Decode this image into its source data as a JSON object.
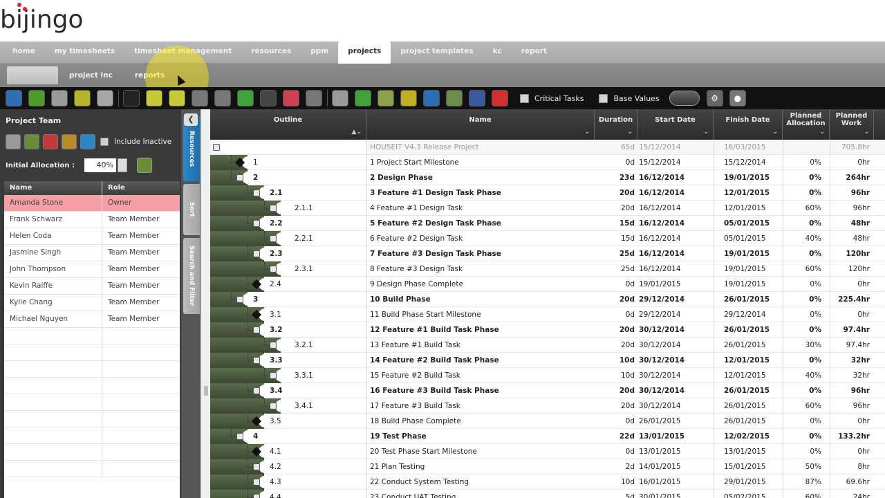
{
  "app": {
    "logo": "bijingo"
  },
  "main_nav": [
    {
      "label": "home",
      "active": false
    },
    {
      "label": "my timesheets",
      "active": false
    },
    {
      "label": "timesheet management",
      "active": false
    },
    {
      "label": "resources",
      "active": false
    },
    {
      "label": "ppm",
      "active": false
    },
    {
      "label": "projects",
      "active": true
    },
    {
      "label": "project templates",
      "active": false
    },
    {
      "label": "kc",
      "active": false
    },
    {
      "label": "report",
      "active": false
    }
  ],
  "sub_nav": [
    {
      "label": "",
      "active": true
    },
    {
      "label": "project inc",
      "active": false
    },
    {
      "label": "reports",
      "active": false
    }
  ],
  "toolbar": {
    "critical_tasks_label": "Critical Tasks",
    "base_values_label": "Base Values",
    "buttons": [
      {
        "icon": "back-icon",
        "color": "#2d6fb6"
      },
      {
        "icon": "add-icon",
        "color": "#4e9a2b"
      },
      {
        "icon": "settings-icon",
        "color": "#9a9a9a"
      },
      {
        "icon": "cube-icon",
        "color": "#b5b52a"
      },
      {
        "icon": "trash-icon",
        "color": "#a7a7a7"
      },
      {
        "icon": "expand-icon",
        "color": "#222222"
      },
      {
        "icon": "indent-icon",
        "color": "#c8c83a"
      },
      {
        "icon": "outdent-icon",
        "color": "#c8c83a"
      },
      {
        "icon": "link-icon",
        "color": "#777777"
      },
      {
        "icon": "unlink-icon",
        "color": "#777777"
      },
      {
        "icon": "pause-icon",
        "color": "#3fa23a"
      },
      {
        "icon": "target-icon",
        "color": "#444444"
      },
      {
        "icon": "stop-icon",
        "color": "#d04055"
      },
      {
        "icon": "chart-icon",
        "color": "#777777"
      },
      {
        "icon": "copy-icon",
        "color": "#9a9a9a"
      },
      {
        "icon": "bars-icon",
        "color": "#3fa23a"
      },
      {
        "icon": "gantt-icon",
        "color": "#8aa04a"
      },
      {
        "icon": "clock-icon",
        "color": "#c0b020"
      },
      {
        "icon": "calendar-icon",
        "color": "#2d6fb6"
      },
      {
        "icon": "refresh-icon",
        "color": "#6b8c4a"
      },
      {
        "icon": "print-icon",
        "color": "#3a5aa0"
      },
      {
        "icon": "pie-icon",
        "color": "#d03030"
      }
    ]
  },
  "left_panel": {
    "title": "Project Team",
    "include_inactive_label": "Include Inactive",
    "initial_allocation_label": "Initial Allocation :",
    "initial_allocation_value": "40%",
    "columns": [
      "Name",
      "Role"
    ],
    "members": [
      {
        "name": "Amanda Stone",
        "role": "Owner",
        "selected": true
      },
      {
        "name": "Frank Schwarz",
        "role": "Team Member",
        "selected": false
      },
      {
        "name": "Helen Coda",
        "role": "Team Member",
        "selected": false
      },
      {
        "name": "Jasmine Singh",
        "role": "Team Member",
        "selected": false
      },
      {
        "name": "John Thompson",
        "role": "Team Member",
        "selected": false
      },
      {
        "name": "Kevin Raiffe",
        "role": "Team Member",
        "selected": false
      },
      {
        "name": "Kylie Chang",
        "role": "Team Member",
        "selected": false
      },
      {
        "name": "Michael Nguyen",
        "role": "Team Member",
        "selected": false
      }
    ]
  },
  "vertical_tabs": [
    {
      "label": "Resources",
      "active": true
    },
    {
      "label": "Sort",
      "active": false
    },
    {
      "label": "Search and Filter",
      "active": false
    }
  ],
  "grid": {
    "columns": {
      "outline": "Outline",
      "name": "Name",
      "duration": "Duration",
      "start": "Start Date",
      "finish": "Finish Date",
      "allocation": "Planned Allocation",
      "work": "Planned Work"
    },
    "rows": [
      {
        "level": 0,
        "kind": "project",
        "outline": "",
        "name": "HOUSEIT V4.3 Release Project",
        "duration": "65d",
        "start": "15/12/2014",
        "finish": "16/03/2015",
        "allocation": "",
        "work": "705.8hr"
      },
      {
        "level": 1,
        "kind": "milestone",
        "outline": "1",
        "name": "1   Project Start Milestone",
        "duration": "0d",
        "start": "15/12/2014",
        "finish": "15/12/2014",
        "allocation": "0%",
        "work": "0hr"
      },
      {
        "level": 1,
        "kind": "summary",
        "outline": "2",
        "name": "2   Design Phase",
        "duration": "23d",
        "start": "16/12/2014",
        "finish": "19/01/2015",
        "allocation": "0%",
        "work": "264hr"
      },
      {
        "level": 2,
        "kind": "summary",
        "outline": "2.1",
        "name": "3   Feature #1 Design Task Phase",
        "duration": "20d",
        "start": "16/12/2014",
        "finish": "12/01/2015",
        "allocation": "0%",
        "work": "96hr"
      },
      {
        "level": 3,
        "kind": "task",
        "outline": "2.1.1",
        "name": "4   Feature #1 Design Task",
        "duration": "20d",
        "start": "16/12/2014",
        "finish": "12/01/2015",
        "allocation": "60%",
        "work": "96hr"
      },
      {
        "level": 2,
        "kind": "summary",
        "outline": "2.2",
        "name": "5   Feature #2 Design Task Phase",
        "duration": "15d",
        "start": "16/12/2014",
        "finish": "05/01/2015",
        "allocation": "0%",
        "work": "48hr"
      },
      {
        "level": 3,
        "kind": "task",
        "outline": "2.2.1",
        "name": "6   Feature #2 Design Task",
        "duration": "15d",
        "start": "16/12/2014",
        "finish": "05/01/2015",
        "allocation": "40%",
        "work": "48hr"
      },
      {
        "level": 2,
        "kind": "summary",
        "outline": "2.3",
        "name": "7   Feature #3 Design Task Phase",
        "duration": "25d",
        "start": "16/12/2014",
        "finish": "19/01/2015",
        "allocation": "0%",
        "work": "120hr"
      },
      {
        "level": 3,
        "kind": "task",
        "outline": "2.3.1",
        "name": "8   Feature #3 Design Task",
        "duration": "25d",
        "start": "16/12/2014",
        "finish": "19/01/2015",
        "allocation": "60%",
        "work": "120hr"
      },
      {
        "level": 2,
        "kind": "milestone",
        "outline": "2.4",
        "name": "9   Design Phase Complete",
        "duration": "0d",
        "start": "19/01/2015",
        "finish": "19/01/2015",
        "allocation": "0%",
        "work": "0hr"
      },
      {
        "level": 1,
        "kind": "summary",
        "outline": "3",
        "name": "10   Build Phase",
        "duration": "20d",
        "start": "29/12/2014",
        "finish": "26/01/2015",
        "allocation": "0%",
        "work": "225.4hr"
      },
      {
        "level": 2,
        "kind": "milestone",
        "outline": "3.1",
        "name": "11   Build Phase Start Milestone",
        "duration": "0d",
        "start": "29/12/2014",
        "finish": "29/12/2014",
        "allocation": "0%",
        "work": "0hr"
      },
      {
        "level": 2,
        "kind": "summary",
        "outline": "3.2",
        "name": "12   Feature #1 Build Task Phase",
        "duration": "20d",
        "start": "30/12/2014",
        "finish": "26/01/2015",
        "allocation": "0%",
        "work": "97.4hr"
      },
      {
        "level": 3,
        "kind": "task",
        "outline": "3.2.1",
        "name": "13   Feature #1 Build Task",
        "duration": "20d",
        "start": "30/12/2014",
        "finish": "26/01/2015",
        "allocation": "30%",
        "work": "97.4hr"
      },
      {
        "level": 2,
        "kind": "summary",
        "outline": "3.3",
        "name": "14   Feature #2 Build Task Phase",
        "duration": "10d",
        "start": "30/12/2014",
        "finish": "12/01/2015",
        "allocation": "0%",
        "work": "32hr"
      },
      {
        "level": 3,
        "kind": "task",
        "outline": "3.3.1",
        "name": "15   Feature #2 Build Task",
        "duration": "10d",
        "start": "30/12/2014",
        "finish": "12/01/2015",
        "allocation": "40%",
        "work": "32hr"
      },
      {
        "level": 2,
        "kind": "summary",
        "outline": "3.4",
        "name": "16   Feature #3 Build Task Phase",
        "duration": "20d",
        "start": "30/12/2014",
        "finish": "26/01/2015",
        "allocation": "0%",
        "work": "96hr"
      },
      {
        "level": 3,
        "kind": "task",
        "outline": "3.4.1",
        "name": "17   Feature #3 Build Task",
        "duration": "20d",
        "start": "30/12/2014",
        "finish": "26/01/2015",
        "allocation": "60%",
        "work": "96hr"
      },
      {
        "level": 2,
        "kind": "milestone",
        "outline": "3.5",
        "name": "18   Build Phase Complete",
        "duration": "0d",
        "start": "26/01/2015",
        "finish": "26/01/2015",
        "allocation": "0%",
        "work": "0hr"
      },
      {
        "level": 1,
        "kind": "summary",
        "outline": "4",
        "name": "19   Test Phase",
        "duration": "22d",
        "start": "13/01/2015",
        "finish": "12/02/2015",
        "allocation": "0%",
        "work": "133.2hr"
      },
      {
        "level": 2,
        "kind": "milestone",
        "outline": "4.1",
        "name": "20   Test Phase Start Milestone",
        "duration": "0d",
        "start": "13/01/2015",
        "finish": "13/01/2015",
        "allocation": "0%",
        "work": "0hr"
      },
      {
        "level": 2,
        "kind": "task",
        "outline": "4.2",
        "name": "21   Plan Testing",
        "duration": "2d",
        "start": "14/01/2015",
        "finish": "15/01/2015",
        "allocation": "50%",
        "work": "8hr"
      },
      {
        "level": 2,
        "kind": "task",
        "outline": "4.3",
        "name": "22   Conduct System Testing",
        "duration": "10d",
        "start": "16/01/2015",
        "finish": "29/01/2015",
        "allocation": "87%",
        "work": "69.6hr"
      },
      {
        "level": 2,
        "kind": "task",
        "outline": "4.4",
        "name": "23   Conduct UAT Testing",
        "duration": "5d",
        "start": "30/01/2015",
        "finish": "05/02/2015",
        "allocation": "60%",
        "work": "24hr"
      }
    ]
  }
}
